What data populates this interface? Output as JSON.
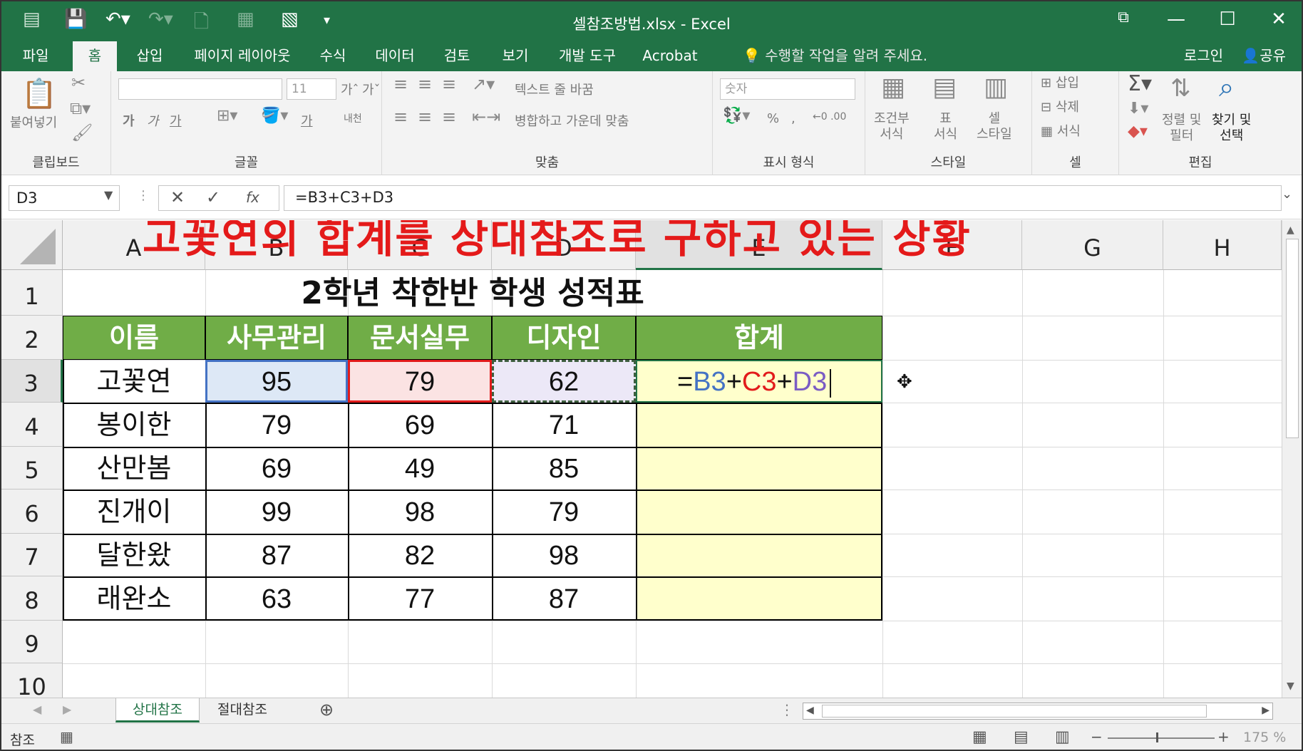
{
  "window": {
    "title": "셀참조방법.xlsx - Excel",
    "quick_access": {
      "save_icon": "save-icon",
      "undo_icon": "undo-icon",
      "redo_icon": "redo-icon"
    },
    "controls": {
      "minimize": "—",
      "maximize": "☐",
      "close": "✕"
    }
  },
  "tabs": [
    {
      "label": "파일"
    },
    {
      "label": "홈"
    },
    {
      "label": "삽입"
    },
    {
      "label": "페이지 레이아웃"
    },
    {
      "label": "수식"
    },
    {
      "label": "데이터"
    },
    {
      "label": "검토"
    },
    {
      "label": "보기"
    },
    {
      "label": "개발 도구"
    },
    {
      "label": "Acrobat"
    }
  ],
  "active_tab": "홈",
  "tell_me": "수행할 작업을 알려 주세요.",
  "login": "로그인",
  "share": "공유",
  "ribbon": {
    "clipboard": {
      "label": "클립보드",
      "paste": "붙여넣기"
    },
    "font": {
      "label": "글꼴",
      "font_size": "11",
      "bold": "가",
      "italic": "가",
      "underline": "가",
      "text_color": "가",
      "phonetic": "내천"
    },
    "align": {
      "label": "맞춤",
      "wrap": "텍스트 줄 바꿈",
      "merge": "병합하고 가운데 맞춤"
    },
    "number": {
      "label": "표시 형식",
      "format": "숫자",
      "percent": "%",
      "comma": ","
    },
    "styles": {
      "label": "스타일",
      "conditional": "조건부\n서식",
      "table": "표\n서식",
      "cell_style": "셀\n스타일"
    },
    "cells": {
      "label": "셀",
      "insert": "삽입",
      "delete": "삭제",
      "format": "서식"
    },
    "editing": {
      "label": "편집",
      "sort": "정렬 및\n필터",
      "find": "찾기 및\n선택"
    }
  },
  "formula_bar": {
    "name_box": "D3",
    "fx": "fx",
    "formula": "=B3+C3+D3"
  },
  "overlay_caption": "고꽃연의 합계를 상대참조로 구하고 있는 상황",
  "columns": [
    "A",
    "B",
    "C",
    "D",
    "E",
    "F",
    "G",
    "H"
  ],
  "rows": [
    "1",
    "2",
    "3",
    "4",
    "5",
    "6",
    "7",
    "8",
    "9",
    "10"
  ],
  "sheet": {
    "title": "2학년 착한반 학생 성적표",
    "headers": [
      "이름",
      "사무관리",
      "문서실무",
      "디자인",
      "합계"
    ],
    "data": [
      {
        "name": "고꽃연",
        "office": "95",
        "doc": "79",
        "design": "62"
      },
      {
        "name": "봉이한",
        "office": "79",
        "doc": "69",
        "design": "71"
      },
      {
        "name": "산만봄",
        "office": "69",
        "doc": "49",
        "design": "85"
      },
      {
        "name": "진개이",
        "office": "99",
        "doc": "98",
        "design": "79"
      },
      {
        "name": "달한왔",
        "office": "87",
        "doc": "82",
        "design": "98"
      },
      {
        "name": "래완소",
        "office": "63",
        "doc": "77",
        "design": "87"
      }
    ],
    "edit_formula": {
      "eq": "=",
      "b": "B3",
      "plus1": "+",
      "c": "C3",
      "plus2": "+",
      "d": "D3"
    }
  },
  "sheet_tabs": [
    {
      "label": "상대참조",
      "active": true
    },
    {
      "label": "절대참조",
      "active": false
    }
  ],
  "status": {
    "mode": "참조",
    "zoom": "175 %"
  },
  "colors": {
    "excel_green": "#217346",
    "header_fill": "#70ad47",
    "sum_fill": "#ffffcc",
    "ref_b": "#4472c4",
    "ref_c": "#e21b1b",
    "ref_d": "#7a5cc4",
    "overlay": "#e41a1a"
  }
}
